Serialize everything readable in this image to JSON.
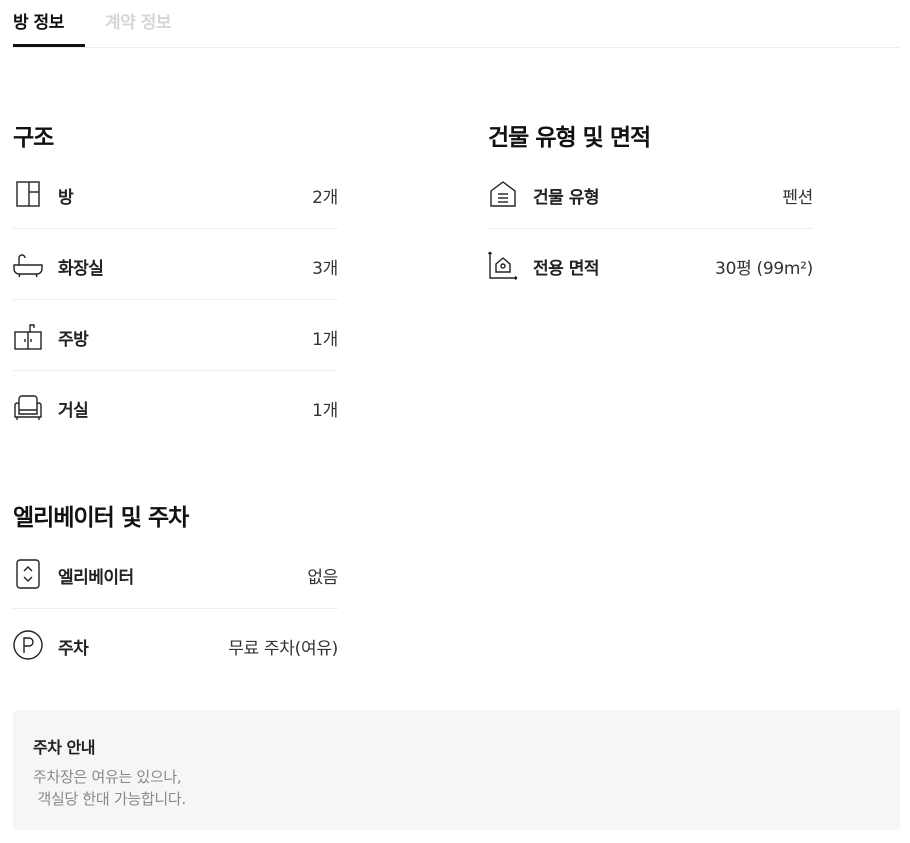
{
  "tabs": [
    {
      "label": "방 정보",
      "active": true
    },
    {
      "label": "계약 정보",
      "active": false
    }
  ],
  "structure": {
    "title": "구조",
    "items": [
      {
        "icon": "room-icon",
        "label": "방",
        "value": "2개"
      },
      {
        "icon": "bathtub-icon",
        "label": "화장실",
        "value": "3개"
      },
      {
        "icon": "kitchen-icon",
        "label": "주방",
        "value": "1개"
      },
      {
        "icon": "armchair-icon",
        "label": "거실",
        "value": "1개"
      }
    ]
  },
  "building": {
    "title": "건물 유형 및 면적",
    "items": [
      {
        "icon": "building-type-icon",
        "label": "건물 유형",
        "value": "펜션"
      },
      {
        "icon": "area-icon",
        "label": "전용 면적",
        "value": "30평 (99m²)"
      }
    ]
  },
  "elevator_parking": {
    "title": "엘리베이터 및 주차",
    "items": [
      {
        "icon": "elevator-icon",
        "label": "엘리베이터",
        "value": "없음"
      },
      {
        "icon": "parking-icon",
        "label": "주차",
        "value": "무료 주차(여유)"
      }
    ]
  },
  "parking_notice": {
    "title": "주차 안내",
    "body": "주차장은 여유는 있으나,\n 객실당 한대 가능합니다."
  }
}
